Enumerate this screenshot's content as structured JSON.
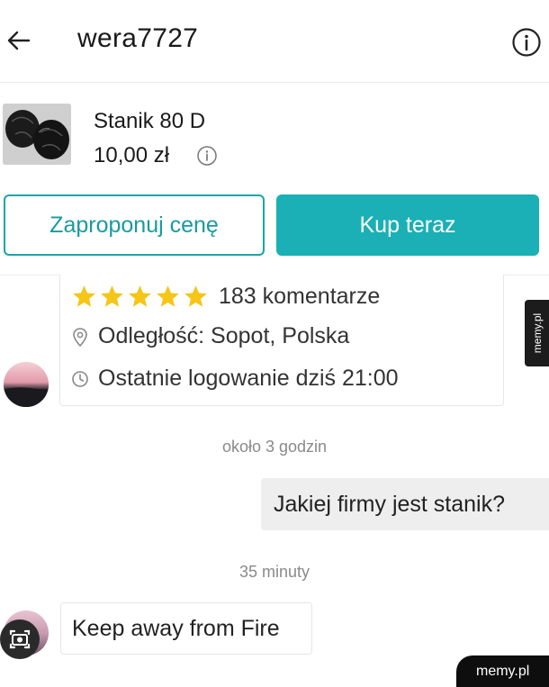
{
  "header": {
    "title": "wera7727"
  },
  "item": {
    "title": "Stanik 80 D",
    "price": "10,00 zł"
  },
  "actions": {
    "offer_label": "Zaproponuj cenę",
    "buy_label": "Kup teraz"
  },
  "seller_card": {
    "rating_stars": 5,
    "reviews": "183 komentarze",
    "location": "Odległość: Sopot, Polska",
    "last_login": "Ostatnie logowanie dziś 21:00"
  },
  "messages": [
    {
      "time": "około  3 godzin",
      "text": "Jakiej firmy jest stanik?",
      "direction": "outgoing"
    },
    {
      "time": "35 minuty",
      "text": "Keep away from Fire",
      "direction": "incoming"
    }
  ],
  "watermark": {
    "side": "memy.pl",
    "corner": "memy.pl"
  },
  "colors": {
    "accent": "#1ab0b5",
    "accent_text": "#1a9aa0",
    "star": "#f5c518"
  },
  "icons": {
    "back": "arrow-left-icon",
    "info": "info-circle-icon",
    "location": "location-pin-icon",
    "clock": "clock-icon",
    "lens": "camera-lens-icon"
  }
}
